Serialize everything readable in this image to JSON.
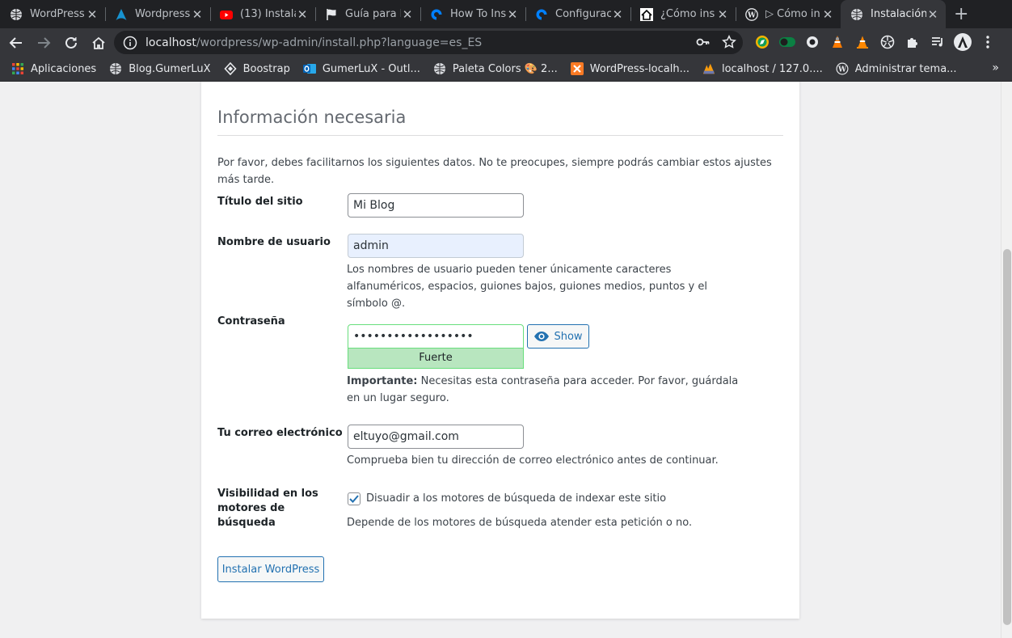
{
  "browser": {
    "tabs": [
      {
        "title": "WordPress",
        "favicon": "globe-icon"
      },
      {
        "title": "Wordpress",
        "favicon": "arch-logo-icon"
      },
      {
        "title": "(13) Instala",
        "favicon": "youtube-icon"
      },
      {
        "title": "Guía para l",
        "favicon": "flag-icon"
      },
      {
        "title": "How To Ins",
        "favicon": "digitalocean-icon"
      },
      {
        "title": "Configurac",
        "favicon": "digitalocean-icon"
      },
      {
        "title": "¿Cómo ins",
        "favicon": "house-icon"
      },
      {
        "title": "▷ Cómo in",
        "favicon": "wordpress-icon"
      },
      {
        "title": "Instalación",
        "favicon": "globe-icon",
        "active": true
      }
    ],
    "url_host": "localhost",
    "url_path": "/wordpress/wp-admin/install.php?language=es_ES",
    "bookmarks": [
      {
        "label": "Aplicaciones",
        "icon": "apps-grid-icon"
      },
      {
        "label": "Blog.GumerLuX",
        "icon": "globe-icon"
      },
      {
        "label": "Boostrap",
        "icon": "boostrap-icon"
      },
      {
        "label": "GumerLuX - Outl...",
        "icon": "outlook-icon"
      },
      {
        "label": "Paleta Colors 🎨 2...",
        "icon": "globe-icon"
      },
      {
        "label": "WordPress-localh...",
        "icon": "xampp-icon"
      },
      {
        "label": "localhost / 127.0....",
        "icon": "phpmyadmin-icon"
      },
      {
        "label": "Administrar tema...",
        "icon": "wordpress-icon"
      }
    ],
    "bookmarks_more": "»"
  },
  "install": {
    "heading": "Información necesaria",
    "intro": "Por favor, debes facilitarnos los siguientes datos. No te preocupes, siempre podrás cambiar estos ajustes más tarde.",
    "site_title_label": "Título del sitio",
    "site_title_value": "Mi Blog",
    "username_label": "Nombre de usuario",
    "username_value": "admin",
    "username_help": "Los nombres de usuario pueden tener únicamente caracteres alfanuméricos, espacios, guiones bajos, guiones medios, puntos y el símbolo @.",
    "password_label": "Contraseña",
    "password_value": "••••••••••••••••••",
    "password_strength": "Fuerte",
    "show_label": "Show",
    "password_important": "Importante:",
    "password_help": " Necesitas esta contraseña para acceder. Por favor, guárdala en un lugar seguro.",
    "email_label": "Tu correo electrónico",
    "email_value": "eltuyo@gmail.com",
    "email_help": "Comprueba bien tu dirección de correo electrónico antes de continuar.",
    "visibility_label": "Visibilidad en los motores de búsqueda",
    "visibility_checkbox_label": "Disuadir a los motores de búsqueda de indexar este sitio",
    "visibility_checked": true,
    "visibility_help": "Depende de los motores de búsqueda atender esta petición o no.",
    "submit_label": "Instalar WordPress"
  },
  "colors": {
    "wp_blue": "#2271b1",
    "strength_strong_bg": "#b8e6bf",
    "strength_strong_border": "#68de7c",
    "autofill_bg": "#e8f0fe"
  }
}
